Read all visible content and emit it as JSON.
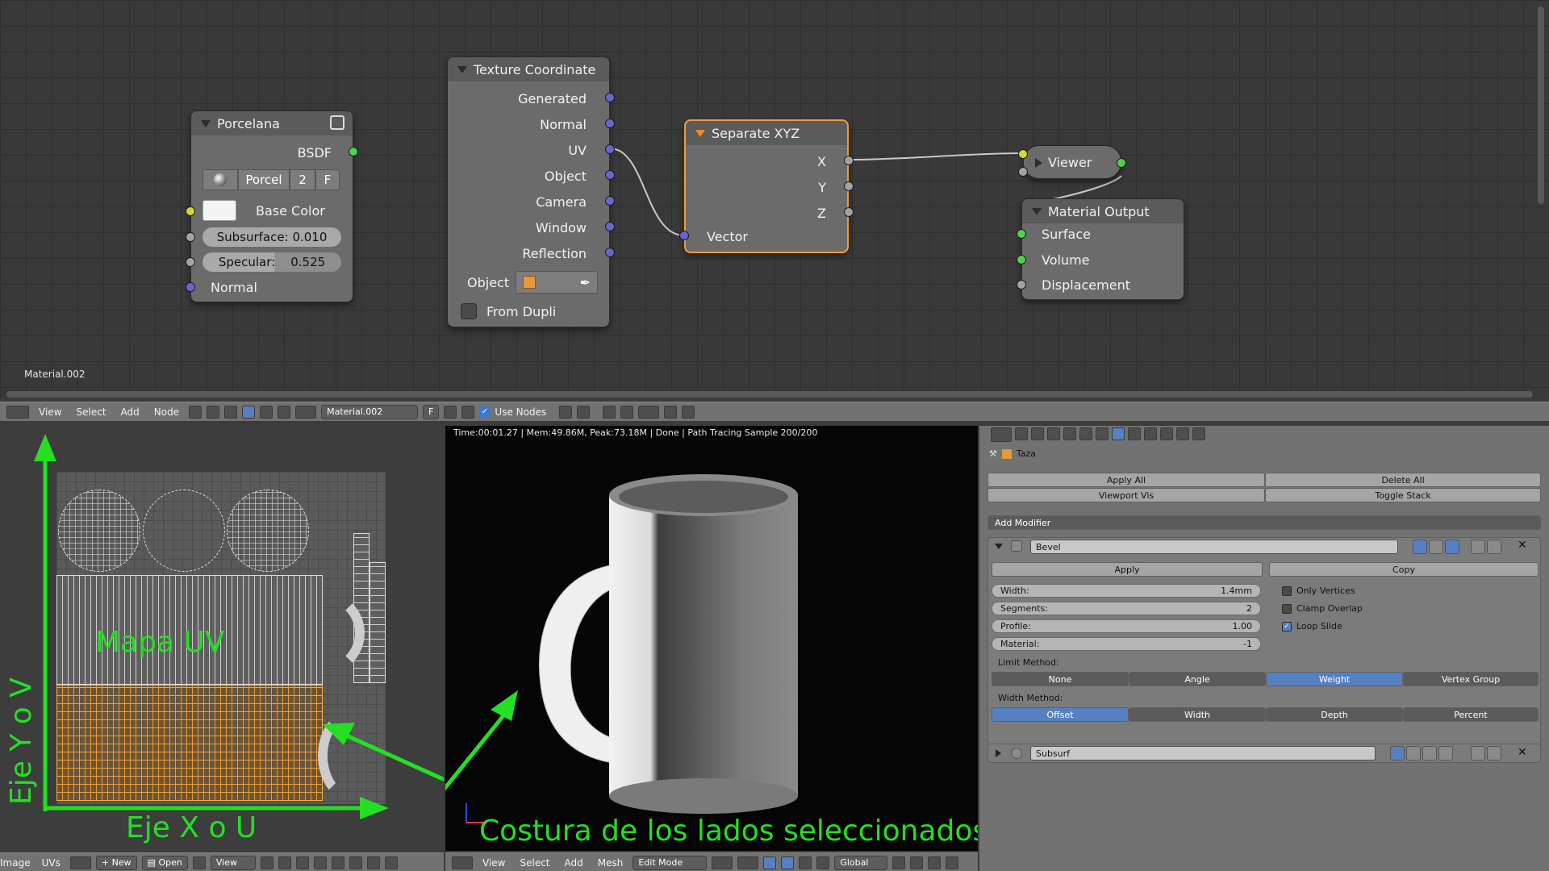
{
  "node_editor": {
    "canvas_label": "Material.002",
    "nodes": {
      "porcelana": {
        "title": "Porcelana",
        "output": "BSDF",
        "material_name": "Porcel",
        "users": "2",
        "fake": "F",
        "base_color_label": "Base Color",
        "subsurface_label": "Subsurface:",
        "subsurface_value": "0.010",
        "specular_label": "Specular:",
        "specular_value": "0.525",
        "normal_label": "Normal"
      },
      "texture_coordinate": {
        "title": "Texture Coordinate",
        "outputs": [
          "Generated",
          "Normal",
          "UV",
          "Object",
          "Camera",
          "Window",
          "Reflection"
        ],
        "object_label": "Object",
        "from_dupli_label": "From Dupli"
      },
      "separate_xyz": {
        "title": "Separate XYZ",
        "outputs": [
          "X",
          "Y",
          "Z"
        ],
        "input": "Vector"
      },
      "viewer": {
        "title": "Viewer"
      },
      "material_output": {
        "title": "Material Output",
        "inputs": [
          "Surface",
          "Volume",
          "Displacement"
        ]
      }
    }
  },
  "node_toolbar": {
    "menus": [
      "View",
      "Select",
      "Add",
      "Node"
    ],
    "material_field": "Material.002",
    "fake_user": "F",
    "use_nodes_label": "Use Nodes"
  },
  "uv_editor": {
    "overlay_title": "Mapa UV",
    "axis_y_label": "Eje Y o V",
    "axis_x_label": "Eje X o U",
    "toolbar": {
      "menus": [
        "Image",
        "UVs"
      ],
      "new_label": "New",
      "open_label": "Open",
      "view_label": "View"
    }
  },
  "viewport": {
    "render_stats": "Time:00:01.27 | Mem:49.86M, Peak:73.18M | Done | Path Tracing Sample 200/200",
    "annotation": "Costura de los lados seleccionados",
    "toolbar": {
      "menus": [
        "View",
        "Select",
        "Add",
        "Mesh"
      ],
      "mode": "Edit Mode",
      "orientation": "Global"
    }
  },
  "properties": {
    "object_name": "Taza",
    "apply_all": "Apply All",
    "delete_all": "Delete All",
    "viewport_vis": "Viewport Vis",
    "toggle_stack": "Toggle Stack",
    "add_modifier": "Add Modifier",
    "bevel": {
      "name": "Bevel",
      "apply": "Apply",
      "copy": "Copy",
      "width_label": "Width:",
      "width_value": "1.4mm",
      "segments_label": "Segments:",
      "segments_value": "2",
      "profile_label": "Profile:",
      "profile_value": "1.00",
      "material_label": "Material:",
      "material_value": "-1",
      "only_vertices": "Only Vertices",
      "clamp_overlap": "Clamp Overlap",
      "loop_slide": "Loop Slide",
      "limit_method_label": "Limit Method:",
      "limit_methods": [
        "None",
        "Angle",
        "Weight",
        "Vertex Group"
      ],
      "limit_active": "Weight",
      "width_method_label": "Width Method:",
      "width_methods": [
        "Offset",
        "Width",
        "Depth",
        "Percent"
      ],
      "width_active": "Offset"
    },
    "subsurf": {
      "name": "Subsurf"
    }
  },
  "colors": {
    "overlay_green": "#23e023",
    "selection_orange": "#f19b3a",
    "active_blue": "#5680c2"
  }
}
